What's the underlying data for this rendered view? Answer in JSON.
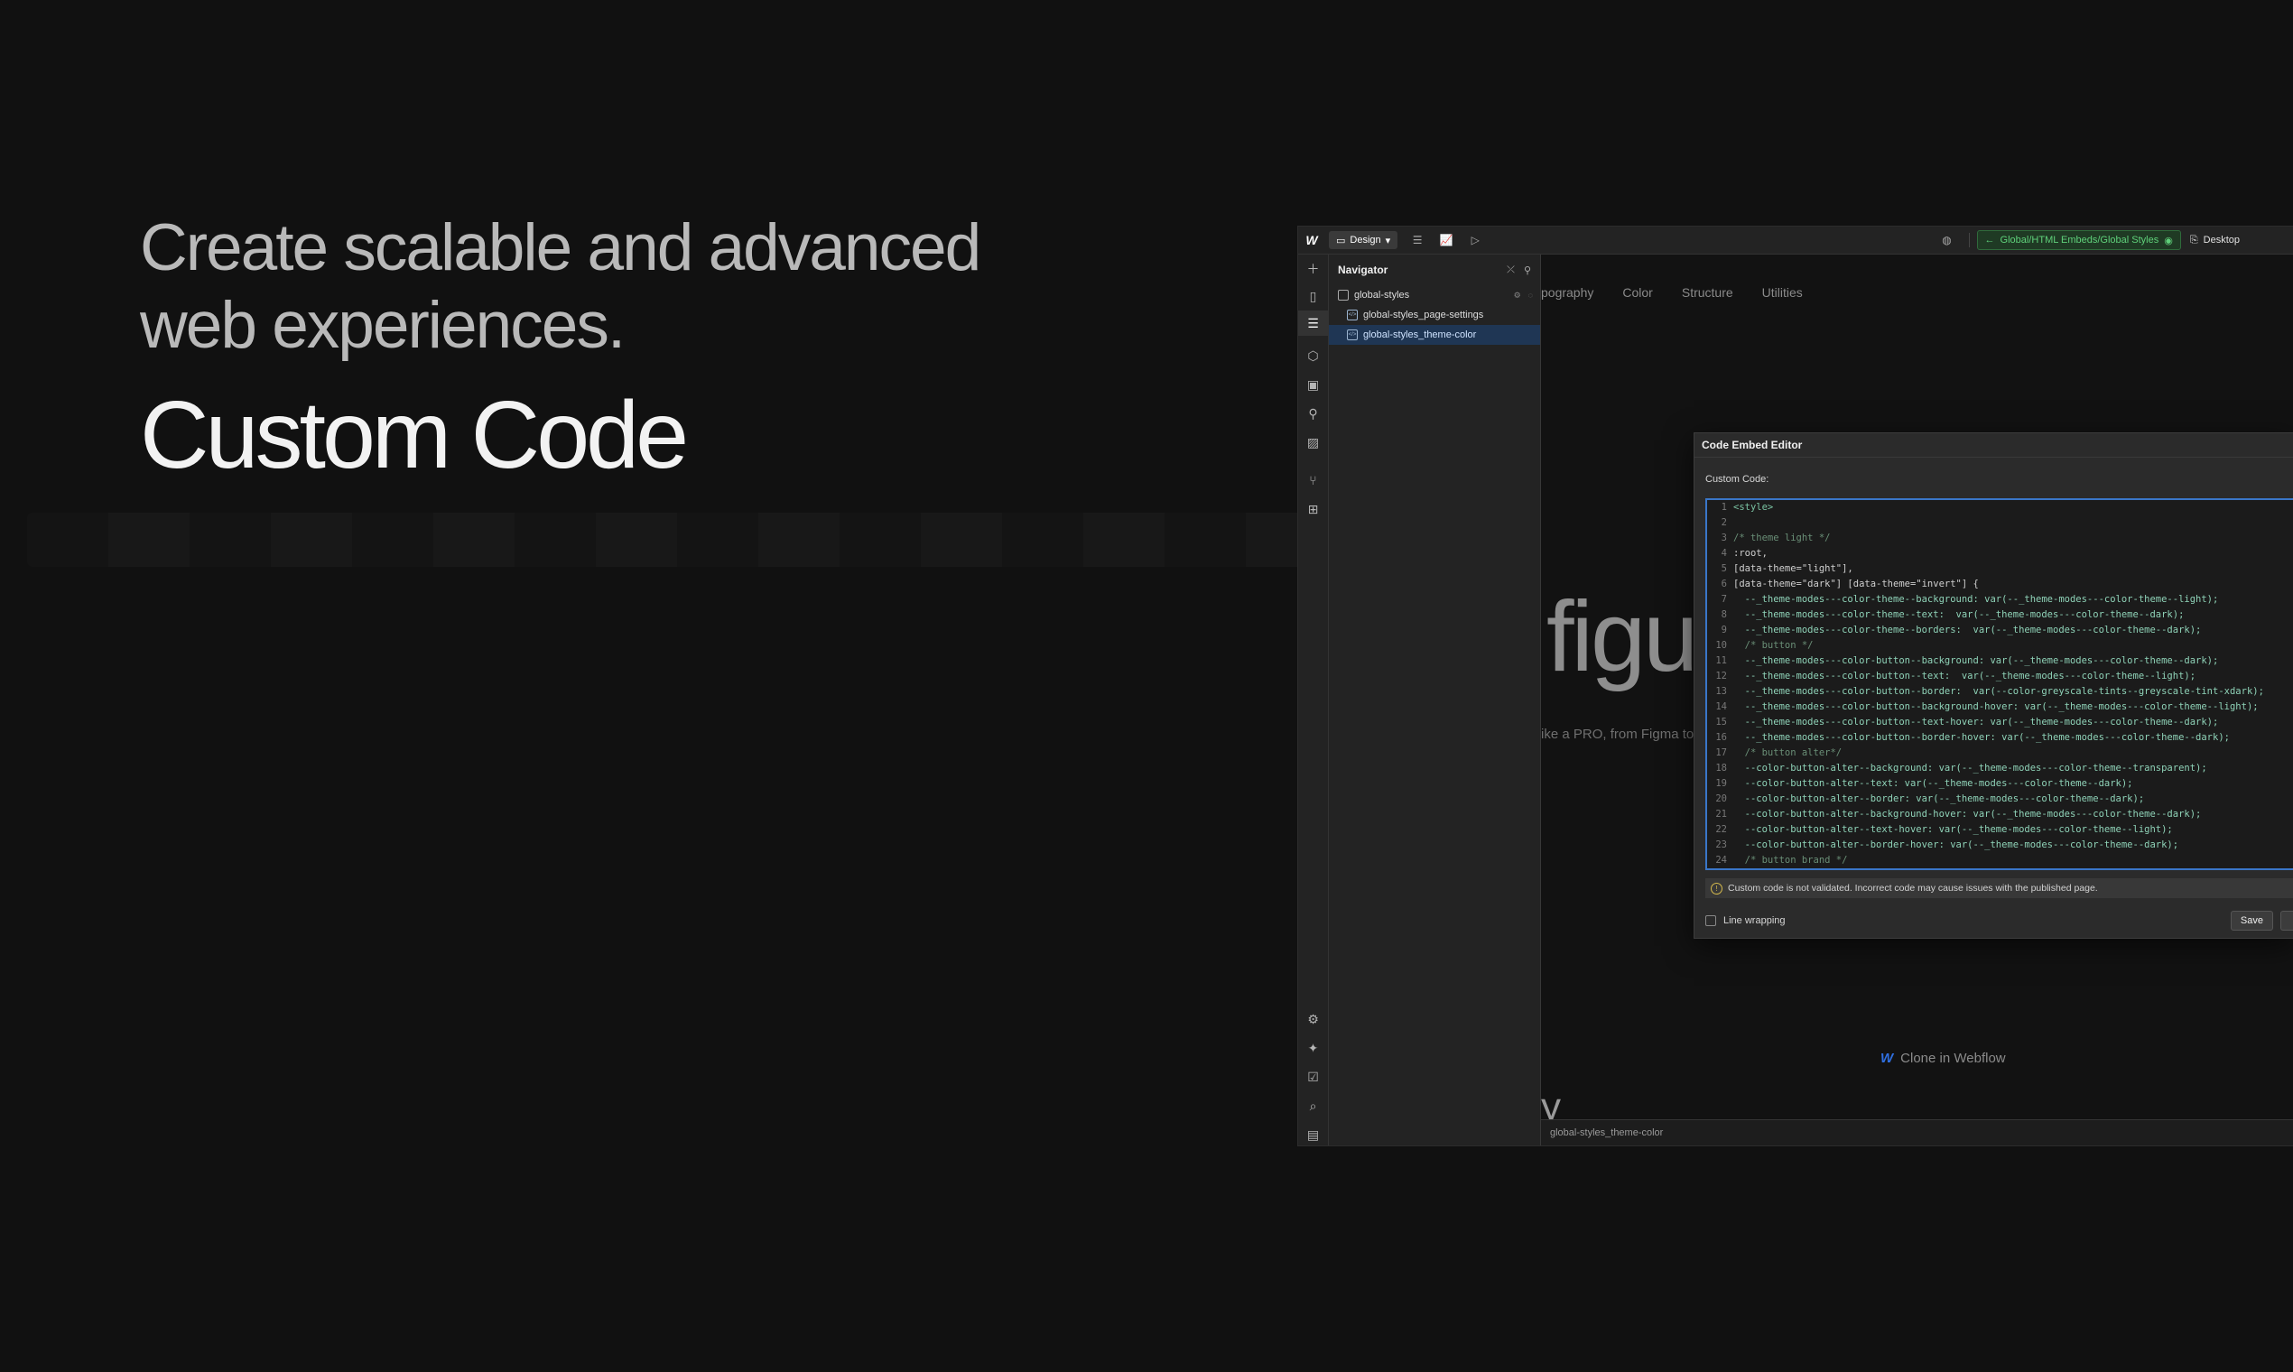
{
  "hero": {
    "line1": "Create scalable and advanced",
    "line2": "web experiences.",
    "title": "Custom Code"
  },
  "topbar": {
    "logo": "W",
    "mode_label": "Design",
    "path_label": "Global/HTML Embeds/Global Styles",
    "device_label": "Desktop"
  },
  "navigator": {
    "title": "Navigator",
    "items": [
      {
        "label": "global-styles"
      },
      {
        "label": "global-styles_page-settings"
      },
      {
        "label": "global-styles_theme-color"
      }
    ]
  },
  "canvas": {
    "tabs": [
      "pography",
      "Color",
      "Structure",
      "Utilities"
    ],
    "big_text": "figu",
    "sub_text": "ike a PRO, from Figma to W",
    "y_text": "y",
    "clone_label": "Clone in Webflow"
  },
  "statusbar": {
    "selection": "global-styles_theme-color"
  },
  "modal": {
    "title": "Code Embed Editor",
    "label": "Custom Code:",
    "warning": "Custom code is not validated. Incorrect code may cause issues with the published page.",
    "line_wrapping": "Line wrapping",
    "save_label": "Save",
    "lines": [
      {
        "n": "1",
        "t": "<style>"
      },
      {
        "n": "2",
        "t": ""
      },
      {
        "n": "3",
        "t": "/* theme light */"
      },
      {
        "n": "4",
        "t": ":root,"
      },
      {
        "n": "5",
        "t": "[data-theme=\"light\"],"
      },
      {
        "n": "6",
        "t": "[data-theme=\"dark\"] [data-theme=\"invert\"] {"
      },
      {
        "n": "7",
        "t": "  --_theme-modes---color-theme--background: var(--_theme-modes---color-theme--light);"
      },
      {
        "n": "8",
        "t": "  --_theme-modes---color-theme--text:  var(--_theme-modes---color-theme--dark);"
      },
      {
        "n": "9",
        "t": "  --_theme-modes---color-theme--borders:  var(--_theme-modes---color-theme--dark);"
      },
      {
        "n": "10",
        "t": "  /* button */"
      },
      {
        "n": "11",
        "t": "  --_theme-modes---color-button--background: var(--_theme-modes---color-theme--dark);"
      },
      {
        "n": "12",
        "t": "  --_theme-modes---color-button--text:  var(--_theme-modes---color-theme--light);"
      },
      {
        "n": "13",
        "t": "  --_theme-modes---color-button--border:  var(--color-greyscale-tints--greyscale-tint-xdark);"
      },
      {
        "n": "14",
        "t": "  --_theme-modes---color-button--background-hover: var(--_theme-modes---color-theme--light);"
      },
      {
        "n": "15",
        "t": "  --_theme-modes---color-button--text-hover: var(--_theme-modes---color-theme--dark);"
      },
      {
        "n": "16",
        "t": "  --_theme-modes---color-button--border-hover: var(--_theme-modes---color-theme--dark);"
      },
      {
        "n": "17",
        "t": "  /* button alter*/"
      },
      {
        "n": "18",
        "t": "  --color-button-alter--background: var(--_theme-modes---color-theme--transparent);"
      },
      {
        "n": "19",
        "t": "  --color-button-alter--text: var(--_theme-modes---color-theme--dark);"
      },
      {
        "n": "20",
        "t": "  --color-button-alter--border: var(--_theme-modes---color-theme--dark);"
      },
      {
        "n": "21",
        "t": "  --color-button-alter--background-hover: var(--_theme-modes---color-theme--dark);"
      },
      {
        "n": "22",
        "t": "  --color-button-alter--text-hover: var(--_theme-modes---color-theme--light);"
      },
      {
        "n": "23",
        "t": "  --color-button-alter--border-hover: var(--_theme-modes---color-theme--dark);"
      },
      {
        "n": "24",
        "t": "  /* button brand */"
      }
    ]
  },
  "colors": {
    "background": "#111111",
    "accent_green": "#5fd07a",
    "selection_blue": "#1f3654",
    "editor_focus": "#3a76c8",
    "webflow_blue": "#2f6fe0"
  },
  "icons": {
    "rail": [
      "add-icon",
      "pages-icon",
      "navigator-icon",
      "components-icon",
      "styles-icon",
      "variables-icon",
      "assets-icon",
      "logic-icon",
      "apps-icon",
      "settings-icon",
      "ai-assistant-icon",
      "audit-icon",
      "find-icon",
      "site-plans-icon"
    ]
  }
}
